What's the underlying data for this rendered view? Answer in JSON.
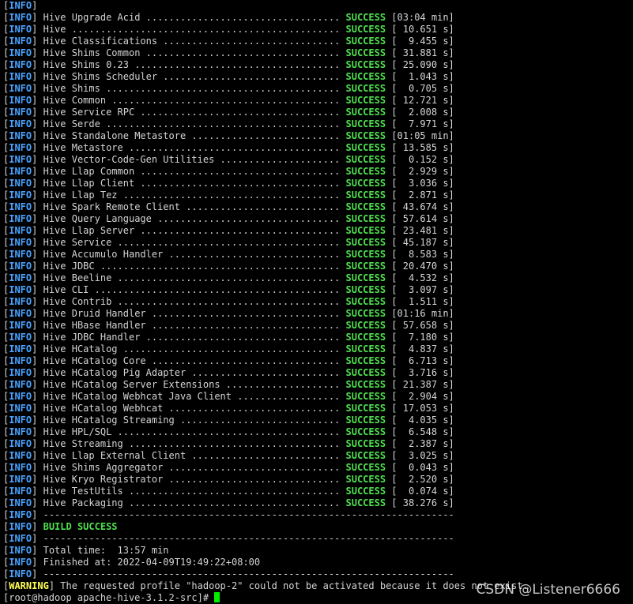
{
  "terminal": {
    "lines": [
      {
        "level": "INFO",
        "text": ""
      },
      {
        "level": "INFO",
        "text": "Hive Upgrade Acid .................................. ",
        "status": "SUCCESS",
        "time": " [03:04 min]"
      },
      {
        "level": "INFO",
        "text": "Hive ............................................... ",
        "status": "SUCCESS",
        "time": " [ 10.651 s]"
      },
      {
        "level": "INFO",
        "text": "Hive Classifications ............................... ",
        "status": "SUCCESS",
        "time": " [  9.455 s]"
      },
      {
        "level": "INFO",
        "text": "Hive Shims Common .................................. ",
        "status": "SUCCESS",
        "time": " [ 31.881 s]"
      },
      {
        "level": "INFO",
        "text": "Hive Shims 0.23 .................................... ",
        "status": "SUCCESS",
        "time": " [ 25.090 s]"
      },
      {
        "level": "INFO",
        "text": "Hive Shims Scheduler ............................... ",
        "status": "SUCCESS",
        "time": " [  1.043 s]"
      },
      {
        "level": "INFO",
        "text": "Hive Shims ......................................... ",
        "status": "SUCCESS",
        "time": " [  0.705 s]"
      },
      {
        "level": "INFO",
        "text": "Hive Common ........................................ ",
        "status": "SUCCESS",
        "time": " [ 12.721 s]"
      },
      {
        "level": "INFO",
        "text": "Hive Service RPC ................................... ",
        "status": "SUCCESS",
        "time": " [  2.008 s]"
      },
      {
        "level": "INFO",
        "text": "Hive Serde ......................................... ",
        "status": "SUCCESS",
        "time": " [  7.971 s]"
      },
      {
        "level": "INFO",
        "text": "Hive Standalone Metastore .......................... ",
        "status": "SUCCESS",
        "time": " [01:05 min]"
      },
      {
        "level": "INFO",
        "text": "Hive Metastore ..................................... ",
        "status": "SUCCESS",
        "time": " [ 13.585 s]"
      },
      {
        "level": "INFO",
        "text": "Hive Vector-Code-Gen Utilities ..................... ",
        "status": "SUCCESS",
        "time": " [  0.152 s]"
      },
      {
        "level": "INFO",
        "text": "Hive Llap Common ................................... ",
        "status": "SUCCESS",
        "time": " [  2.929 s]"
      },
      {
        "level": "INFO",
        "text": "Hive Llap Client ................................... ",
        "status": "SUCCESS",
        "time": " [  3.036 s]"
      },
      {
        "level": "INFO",
        "text": "Hive Llap Tez ...................................... ",
        "status": "SUCCESS",
        "time": " [  2.871 s]"
      },
      {
        "level": "INFO",
        "text": "Hive Spark Remote Client ........................... ",
        "status": "SUCCESS",
        "time": " [ 43.674 s]"
      },
      {
        "level": "INFO",
        "text": "Hive Query Language ................................ ",
        "status": "SUCCESS",
        "time": " [ 57.614 s]"
      },
      {
        "level": "INFO",
        "text": "Hive Llap Server ................................... ",
        "status": "SUCCESS",
        "time": " [ 23.481 s]"
      },
      {
        "level": "INFO",
        "text": "Hive Service ....................................... ",
        "status": "SUCCESS",
        "time": " [ 45.187 s]"
      },
      {
        "level": "INFO",
        "text": "Hive Accumulo Handler .............................. ",
        "status": "SUCCESS",
        "time": " [  8.583 s]"
      },
      {
        "level": "INFO",
        "text": "Hive JDBC .......................................... ",
        "status": "SUCCESS",
        "time": " [ 20.470 s]"
      },
      {
        "level": "INFO",
        "text": "Hive Beeline ....................................... ",
        "status": "SUCCESS",
        "time": " [  4.532 s]"
      },
      {
        "level": "INFO",
        "text": "Hive CLI ........................................... ",
        "status": "SUCCESS",
        "time": " [  3.097 s]"
      },
      {
        "level": "INFO",
        "text": "Hive Contrib ....................................... ",
        "status": "SUCCESS",
        "time": " [  1.511 s]"
      },
      {
        "level": "INFO",
        "text": "Hive Druid Handler ................................. ",
        "status": "SUCCESS",
        "time": " [01:16 min]"
      },
      {
        "level": "INFO",
        "text": "Hive HBase Handler ................................. ",
        "status": "SUCCESS",
        "time": " [ 57.658 s]"
      },
      {
        "level": "INFO",
        "text": "Hive JDBC Handler .................................. ",
        "status": "SUCCESS",
        "time": " [  7.180 s]"
      },
      {
        "level": "INFO",
        "text": "Hive HCatalog ...................................... ",
        "status": "SUCCESS",
        "time": " [  4.837 s]"
      },
      {
        "level": "INFO",
        "text": "Hive HCatalog Core ................................. ",
        "status": "SUCCESS",
        "time": " [  6.713 s]"
      },
      {
        "level": "INFO",
        "text": "Hive HCatalog Pig Adapter .......................... ",
        "status": "SUCCESS",
        "time": " [  3.716 s]"
      },
      {
        "level": "INFO",
        "text": "Hive HCatalog Server Extensions .................... ",
        "status": "SUCCESS",
        "time": " [ 21.387 s]"
      },
      {
        "level": "INFO",
        "text": "Hive HCatalog Webhcat Java Client .................. ",
        "status": "SUCCESS",
        "time": " [  2.904 s]"
      },
      {
        "level": "INFO",
        "text": "Hive HCatalog Webhcat .............................. ",
        "status": "SUCCESS",
        "time": " [ 17.053 s]"
      },
      {
        "level": "INFO",
        "text": "Hive HCatalog Streaming ............................ ",
        "status": "SUCCESS",
        "time": " [  4.035 s]"
      },
      {
        "level": "INFO",
        "text": "Hive HPL/SQL ....................................... ",
        "status": "SUCCESS",
        "time": " [  6.548 s]"
      },
      {
        "level": "INFO",
        "text": "Hive Streaming ..................................... ",
        "status": "SUCCESS",
        "time": " [  2.387 s]"
      },
      {
        "level": "INFO",
        "text": "Hive Llap External Client .......................... ",
        "status": "SUCCESS",
        "time": " [  3.025 s]"
      },
      {
        "level": "INFO",
        "text": "Hive Shims Aggregator .............................. ",
        "status": "SUCCESS",
        "time": " [  0.043 s]"
      },
      {
        "level": "INFO",
        "text": "Hive Kryo Registrator .............................. ",
        "status": "SUCCESS",
        "time": " [  2.520 s]"
      },
      {
        "level": "INFO",
        "text": "Hive TestUtils ..................................... ",
        "status": "SUCCESS",
        "time": " [  0.074 s]"
      },
      {
        "level": "INFO",
        "text": "Hive Packaging ..................................... ",
        "status": "SUCCESS",
        "time": " [ 38.276 s]"
      },
      {
        "level": "INFO",
        "text": "------------------------------------------------------------------------"
      },
      {
        "level": "INFO",
        "text": "",
        "highlight": "BUILD SUCCESS"
      },
      {
        "level": "INFO",
        "text": "------------------------------------------------------------------------"
      },
      {
        "level": "INFO",
        "text": "Total time:  13:57 min"
      },
      {
        "level": "INFO",
        "text": "Finished at: 2022-04-09T19:49:22+08:00"
      },
      {
        "level": "INFO",
        "text": "------------------------------------------------------------------------"
      },
      {
        "level": "WARNING",
        "text": "The requested profile \"hadoop-2\" could not be activated because it does not exist."
      }
    ],
    "prompt": "[root@hadoop apache-hive-3.1.2-src]# "
  },
  "watermark": "CSDN @Listener6666",
  "colors": {
    "background": "#000000",
    "text": "#d4d4d4",
    "info": "#4aa3ff",
    "warning": "#ffff55",
    "success": "#4fe04f",
    "cursor": "#00ee00"
  }
}
